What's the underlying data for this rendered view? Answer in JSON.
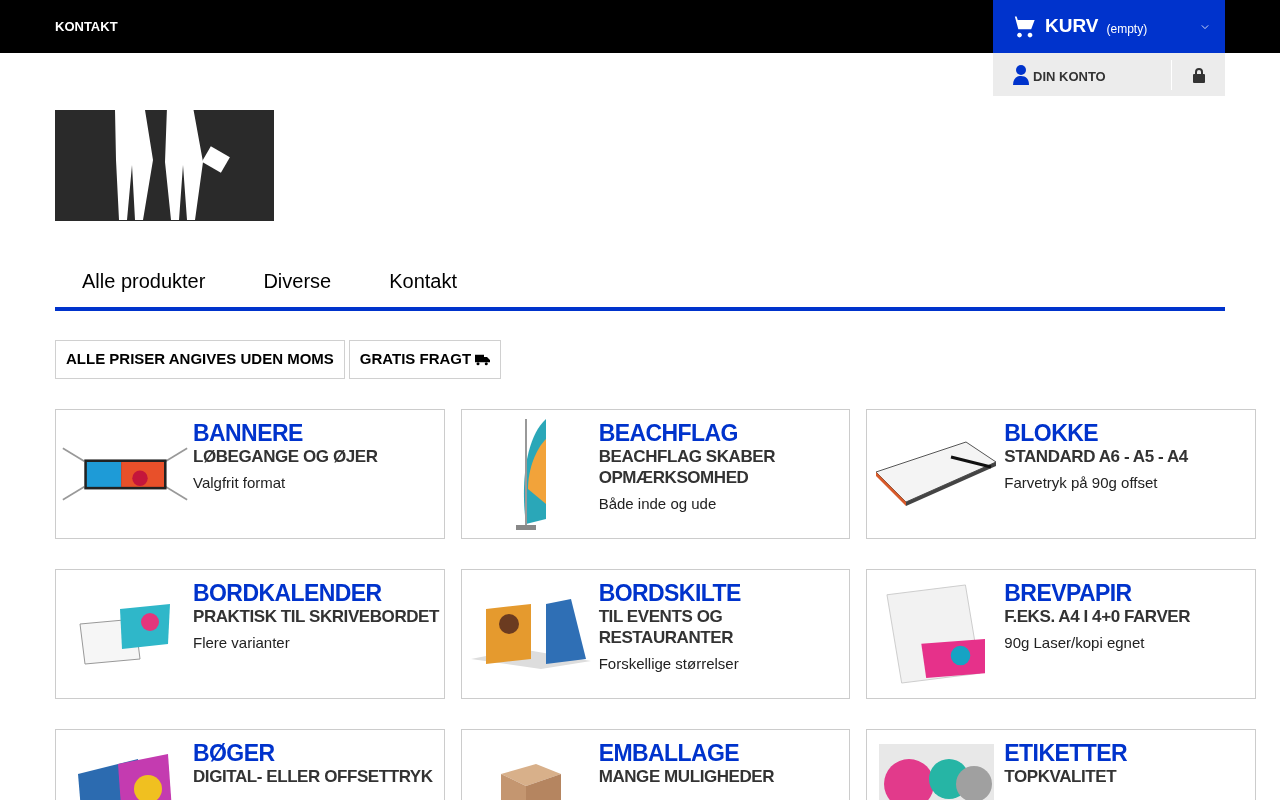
{
  "top_bar": {
    "link": "KONTAKT"
  },
  "cart": {
    "label": "KURV",
    "status": "(empty)"
  },
  "account": {
    "label": "DIN KONTO"
  },
  "nav": [
    {
      "label": "Alle produkter"
    },
    {
      "label": "Diverse"
    },
    {
      "label": "Kontakt"
    }
  ],
  "notices": [
    {
      "text": "ALLE PRISER ANGIVES UDEN MOMS",
      "icon": false
    },
    {
      "text": "GRATIS FRAGT",
      "icon": true
    }
  ],
  "products": [
    {
      "title": "BANNERE",
      "subtitle": "LØBEGANGE OG ØJER",
      "description": "Valgfrit format",
      "kind": "banner"
    },
    {
      "title": "BEACHFLAG",
      "subtitle": "BEACHFLAG SKABER OPMÆRKSOMHED",
      "description": "Både inde og ude",
      "kind": "flag"
    },
    {
      "title": "BLOKKE",
      "subtitle": "STANDARD A6 - A5 - A4",
      "description": "Farvetryk på 90g offset",
      "kind": "pad"
    },
    {
      "title": "BORDKALENDER",
      "subtitle": "PRAKTISK TIL SKRIVEBORDET",
      "description": "Flere varianter",
      "kind": "calendar"
    },
    {
      "title": "BORDSKILTE",
      "subtitle": "TIL EVENTS OG RESTAURANTER",
      "description": "Forskellige størrelser",
      "kind": "sign"
    },
    {
      "title": "BREVPAPIR",
      "subtitle": "F.EKS. A4 I 4+0 FARVER",
      "description": "90g Laser/kopi egnet",
      "kind": "paper"
    },
    {
      "title": "BØGER",
      "subtitle": "DIGITAL- ELLER OFFSETTRYK",
      "kind": "book"
    },
    {
      "title": "EMBALLAGE",
      "subtitle": "MANGE MULIGHEDER",
      "kind": "box"
    },
    {
      "title": "ETIKETTER",
      "subtitle": "TOPKVALITET",
      "kind": "label"
    }
  ]
}
